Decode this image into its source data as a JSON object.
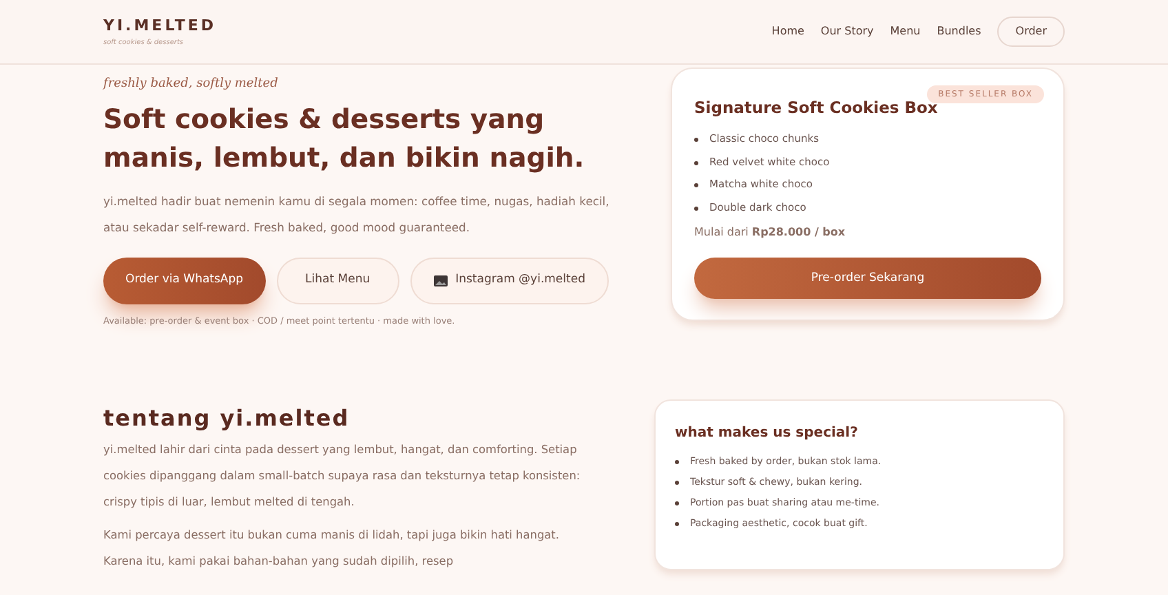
{
  "header": {
    "brand": "YI.MELTED",
    "tagline": "soft cookies & desserts",
    "nav": [
      {
        "label": "Home",
        "kind": "link"
      },
      {
        "label": "Our Story",
        "kind": "link"
      },
      {
        "label": "Menu",
        "kind": "link"
      },
      {
        "label": "Bundles",
        "kind": "link"
      },
      {
        "label": "Order",
        "kind": "pill"
      }
    ]
  },
  "hero": {
    "kicker": "freshly baked, softly melted",
    "title": "Soft cookies & desserts yang manis, lembut, dan bikin nagih.",
    "description": "yi.melted hadir buat nemenin kamu di segala momen: coffee time, nugas, hadiah kecil, atau sekadar self-reward. Fresh baked, good mood guaranteed.",
    "buttons": [
      {
        "label": "Order via WhatsApp",
        "kind": "primary"
      },
      {
        "label": "Lihat Menu",
        "kind": "outline"
      },
      {
        "label": "Instagram @yi.melted",
        "kind": "instagram"
      }
    ],
    "note": "Available: pre-order & event box · COD / meet point tertentu · made with love."
  },
  "featured_card": {
    "badge": "BEST SELLER BOX",
    "title": "Signature Soft Cookies Box",
    "items": [
      "Classic choco chunks",
      "Red velvet white choco",
      "Matcha white choco",
      "Double dark choco"
    ],
    "price": "Mulai dari **Rp28.000 / box**",
    "button": "Pre-order Sekarang"
  },
  "about": {
    "title": "tentang yi.melted",
    "paragraphs": [
      "yi.melted lahir dari cinta pada dessert yang lembut, hangat, dan comforting. Setiap cookies dipanggang dalam small-batch supaya rasa dan teksturnya tetap konsisten: crispy tipis di luar, lembut melted di tengah.",
      "Kami percaya dessert itu bukan cuma manis di lidah, tapi juga bikin hati hangat. Karena itu, kami pakai bahan-bahan yang sudah dipilih, resep"
    ]
  },
  "special_card": {
    "title": "what makes us special?",
    "items": [
      "Fresh baked by order, bukan stok lama.",
      "Tekstur soft & chewy, bukan kering.",
      "Portion pas buat sharing atau me-time.",
      "Packaging aesthetic, cocok buat gift."
    ]
  }
}
